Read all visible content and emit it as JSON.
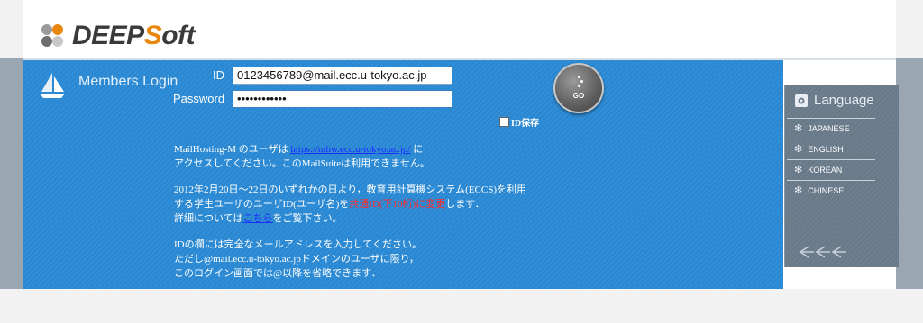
{
  "brand": {
    "logo_text_a": "DEEP",
    "logo_text_b": "S",
    "logo_text_c": "oft",
    "dot_colors": [
      "#9a9a9a",
      "#e8860d",
      "#6e6e6e",
      "#c8c8c8",
      "#505050"
    ]
  },
  "login": {
    "section_label": "Members Login",
    "id_label": "ID",
    "id_value": "0123456789@mail.ecc.u-tokyo.ac.jp",
    "password_label": "Password",
    "password_value": "••••••••••••",
    "go_label": "GO",
    "save_id_label": "ID保存"
  },
  "notices": {
    "p1_part1": "MailHosting-M のユーザは ",
    "p1_link": "https://mhw.ecc.u-tokyo.ac.jp/",
    "p1_part2": " に",
    "p1_line2": "アクセスしてください。このMailSuiteは利用できません。",
    "p2_line1": "2012年2月20日〜22日のいずれかの日より，教育用計算機システム(ECCS)を利用",
    "p2_line2_a": "する学生ユーザのユーザID(ユーザ名)を",
    "p2_line2_red": "共通ID(下10桁)に変更",
    "p2_line2_b": "します．",
    "p2_line3_a": "詳細については",
    "p2_link": "こちら",
    "p2_line3_b": "をご覧下さい。",
    "p3_line1": "IDの欄には完全なメールアドレスを入力してください。",
    "p3_line2": "ただし@mail.ecc.u-tokyo.ac.jpドメインのユーザに限り，",
    "p3_line3": "このログイン画面では@以降を省略できます．"
  },
  "language": {
    "title": "Language",
    "options": [
      "JAPANESE",
      "ENGLISH",
      "KOREAN",
      "CHINESE"
    ],
    "icons": {
      "title": "gear-icon",
      "item": "asterisk-icon",
      "footer": "triple-left-arrow-icon"
    }
  },
  "colors": {
    "band_blue": "#2f8fd8",
    "link_blue": "#1c2cff",
    "alert_red": "#ff2a2a",
    "accent_orange": "#e8860d"
  }
}
